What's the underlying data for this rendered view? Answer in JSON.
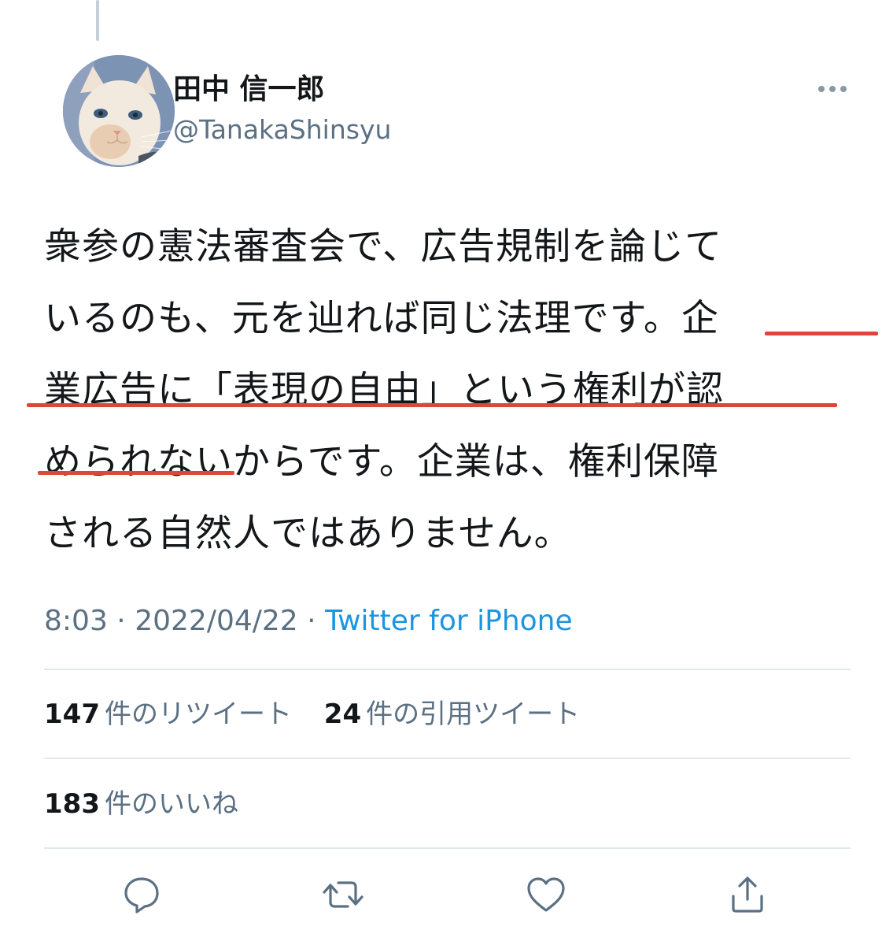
{
  "tweet": {
    "author": {
      "display_name": "田中 信一郎",
      "handle": "@TanakaShinsyu",
      "avatar_icon": "cat-avatar"
    },
    "text_lines": [
      "衆参の憲法審査会で、広告規制を論じて",
      "いるのも、元を辿れば同じ法理です。企",
      "業広告に「表現の自由」という権利が認",
      "められないからです。企業は、権利保障",
      "される自然人ではありません。"
    ],
    "highlight_color": "#e0453a",
    "time": "8:03",
    "date": "2022/04/22",
    "separator": "·",
    "source": "Twitter for iPhone",
    "stats": {
      "retweets": {
        "count": "147",
        "label": "件のリツイート"
      },
      "quotes": {
        "count": "24",
        "label": "件の引用ツイート"
      },
      "likes": {
        "count": "183",
        "label": "件のいいね"
      }
    },
    "actions": [
      "reply-icon",
      "retweet-icon",
      "like-icon",
      "share-icon"
    ]
  },
  "colors": {
    "text": "#14171a",
    "secondary": "#5b7083",
    "link": "#1b95e0",
    "divider": "#e1e8ed"
  }
}
